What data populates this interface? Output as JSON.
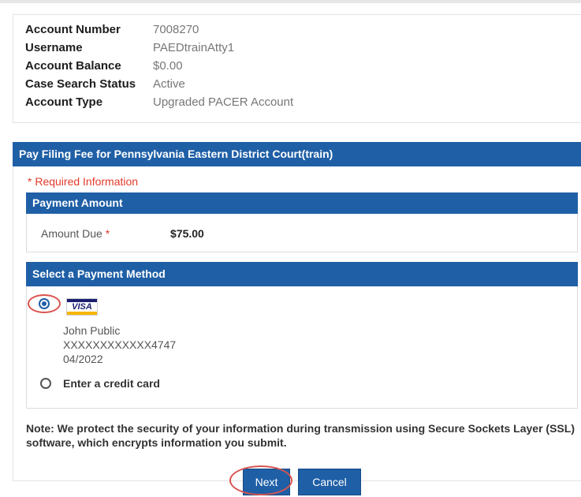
{
  "account": {
    "rows": [
      {
        "label": "Account Number",
        "value": "7008270"
      },
      {
        "label": "Username",
        "value": "PAEDtrainAtty1"
      },
      {
        "label": "Account Balance",
        "value": "$0.00"
      },
      {
        "label": "Case Search Status",
        "value": "Active"
      },
      {
        "label": "Account Type",
        "value": "Upgraded PACER Account"
      }
    ]
  },
  "page_title": "Pay Filing Fee for Pennsylvania Eastern District Court(train)",
  "required_note": "* Required Information",
  "payment_amount": {
    "header": "Payment Amount",
    "label": "Amount Due",
    "required_mark": "*",
    "value": "$75.00"
  },
  "payment_method": {
    "header": "Select a Payment Method",
    "saved_card": {
      "brand": "VISA",
      "name": "John Public",
      "number": "XXXXXXXXXXXX4747",
      "expiry": "04/2022",
      "selected": true
    },
    "new_card_label": "Enter a credit card"
  },
  "security_note": "Note: We protect the security of your information during transmission using Secure Sockets Layer (SSL) software, which encrypts information you submit.",
  "buttons": {
    "next": "Next",
    "cancel": "Cancel"
  },
  "colors": {
    "header_bar": "#1f5fa6",
    "required": "#e23a2a",
    "annotation_circle": "#d9534f"
  }
}
